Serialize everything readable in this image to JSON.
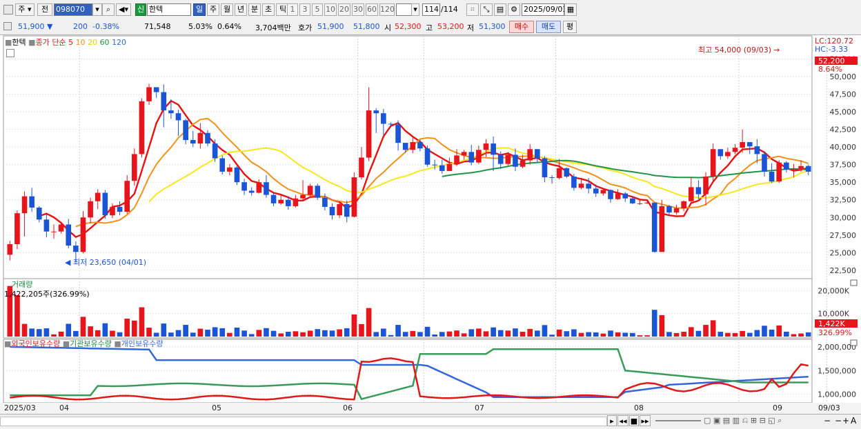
{
  "toolbar": {
    "mode_label": "주",
    "prev_label": "전",
    "code": "098070",
    "shin": "신",
    "stock_name": "한텍",
    "periods": [
      "일",
      "주",
      "월",
      "년",
      "분",
      "초",
      "틱"
    ],
    "active_period": "일",
    "nums": [
      "1",
      "3",
      "5",
      "10",
      "20",
      "30",
      "60",
      "120"
    ],
    "count": "114",
    "count_total": "/114",
    "date": "2025/09/03"
  },
  "quote": {
    "price": "51,900",
    "arrow": "▼",
    "change": "200",
    "change_pct": "-0.38%",
    "volume": "71,548",
    "vol_pct": "5.03%",
    "turnover": "0.64%",
    "value": "3,704백만",
    "hoga_label": "호가",
    "ask": "51,900",
    "bid": "51,800",
    "open_label": "시",
    "open": "52,300",
    "high_label": "고",
    "high": "53,200",
    "low_label": "저",
    "low": "51,300",
    "buy_label": "매수",
    "sell_label": "매도",
    "eval_label": "평"
  },
  "legend": {
    "name": "한텍",
    "type": "종가",
    "ma_label": "단순",
    "mas": [
      "5",
      "10",
      "20",
      "60",
      "120"
    ]
  },
  "annotations": {
    "high_text": "최고 54,000 (09/03)",
    "low_text": "최저 23,650 (04/01)",
    "lc": "LC:120.72",
    "hc": "HC:-3.33",
    "cur_price": "52,200",
    "cur_pct": "8.64%",
    "vol_title": "거래량",
    "vol_info": "1,422,205주(326.99%)",
    "vol_cur": "1,422K",
    "vol_pct": "326.99%",
    "hold_labels": [
      "외국인보유수량",
      "기관보유수량",
      "개인보유수량"
    ]
  },
  "axis": {
    "price_ticks": [
      "52,500",
      "50,000",
      "47,500",
      "45,000",
      "42,500",
      "40,000",
      "37,500",
      "35,000",
      "32,500",
      "30,000",
      "27,500",
      "25,000",
      "22,500"
    ],
    "vol_ticks": [
      "20,000K",
      "10,000K"
    ],
    "hold_ticks": [
      "2,000,000",
      "1,500,000",
      "1,000,000"
    ],
    "x_labels": [
      "2025/03",
      "04",
      "05",
      "06",
      "07",
      "08",
      "09"
    ],
    "x_end": "09/03"
  },
  "colors": {
    "up": "#e8141c",
    "down": "#1a55d8",
    "ma5": "#e81010",
    "ma10": "#f29018",
    "ma20": "#f8e81a",
    "ma60": "#1f9444",
    "ma120": "#2d6cd0",
    "foreign": "#e01818",
    "inst": "#3a9a5a",
    "indiv": "#3366dd"
  },
  "chart_data": {
    "type": "candlestick",
    "ylim": [
      21500,
      55500
    ],
    "candles": [
      [
        24700,
        26200,
        23900,
        26700
      ],
      [
        26200,
        30600,
        25500,
        31000
      ],
      [
        30600,
        33000,
        27300,
        33700
      ],
      [
        33000,
        31400,
        30800,
        34200
      ],
      [
        31400,
        29700,
        29300,
        31600
      ],
      [
        29700,
        28000,
        27200,
        30500
      ],
      [
        28000,
        28000,
        27000,
        29000
      ],
      [
        28000,
        29000,
        27700,
        29400
      ],
      [
        29000,
        26000,
        25600,
        29800
      ],
      [
        26000,
        25100,
        23650,
        26600
      ],
      [
        25100,
        30000,
        24900,
        30900
      ],
      [
        30000,
        32300,
        29200,
        32800
      ],
      [
        32300,
        33500,
        31200,
        34000
      ],
      [
        33500,
        30300,
        29800,
        33900
      ],
      [
        30300,
        31500,
        29900,
        32000
      ],
      [
        31500,
        30800,
        30300,
        32300
      ],
      [
        30800,
        35200,
        30500,
        36000
      ],
      [
        35200,
        39000,
        34500,
        39800
      ],
      [
        39000,
        46500,
        38500,
        46900
      ],
      [
        46500,
        48500,
        46000,
        49000
      ],
      [
        48500,
        47800,
        47000,
        48400
      ],
      [
        47800,
        45200,
        42800,
        48900
      ],
      [
        45200,
        44800,
        44000,
        46800
      ],
      [
        44800,
        43800,
        41600,
        45300
      ],
      [
        43800,
        41000,
        40400,
        44000
      ],
      [
        41000,
        40500,
        40000,
        42300
      ],
      [
        40500,
        42000,
        39800,
        43400
      ],
      [
        42000,
        40500,
        40100,
        42400
      ],
      [
        40500,
        38400,
        37900,
        41100
      ],
      [
        38400,
        36500,
        36100,
        38800
      ],
      [
        36500,
        37100,
        36000,
        37600
      ],
      [
        37100,
        35000,
        34600,
        37300
      ],
      [
        35000,
        33800,
        33200,
        35500
      ],
      [
        33800,
        33500,
        33100,
        34300
      ],
      [
        33500,
        35000,
        33400,
        35400
      ],
      [
        35000,
        33200,
        32800,
        36000
      ],
      [
        33200,
        32000,
        31600,
        33600
      ],
      [
        32000,
        32500,
        31800,
        33100
      ],
      [
        32500,
        31600,
        31100,
        33000
      ],
      [
        31600,
        32700,
        31400,
        33200
      ],
      [
        32700,
        33200,
        32500,
        35300
      ],
      [
        33200,
        34500,
        33000,
        34800
      ],
      [
        34500,
        32800,
        32500,
        34800
      ],
      [
        32800,
        31500,
        31000,
        33400
      ],
      [
        31500,
        30300,
        29700,
        32000
      ],
      [
        30300,
        31900,
        29900,
        32300
      ],
      [
        31900,
        30100,
        29300,
        32400
      ],
      [
        30100,
        35700,
        30000,
        36400
      ],
      [
        35700,
        38500,
        35400,
        40000
      ],
      [
        38500,
        45200,
        38000,
        48500
      ],
      [
        45200,
        44800,
        42000,
        45500
      ],
      [
        44800,
        43300,
        41700,
        45400
      ],
      [
        43300,
        43200,
        42800,
        43500
      ],
      [
        43200,
        40600,
        39500,
        43800
      ],
      [
        40600,
        39600,
        39200,
        40500
      ],
      [
        39600,
        40700,
        39100,
        41300
      ],
      [
        40700,
        39800,
        39400,
        41000
      ],
      [
        39800,
        37500,
        37200,
        40200
      ],
      [
        37500,
        37400,
        36800,
        38200
      ],
      [
        37400,
        36600,
        36200,
        38200
      ],
      [
        36600,
        37600,
        36600,
        38500
      ],
      [
        37600,
        38800,
        37300,
        39700
      ],
      [
        38800,
        39300,
        38200,
        39600
      ],
      [
        39300,
        37800,
        37400,
        40300
      ],
      [
        37800,
        39600,
        37600,
        40200
      ],
      [
        39600,
        40500,
        38600,
        41100
      ],
      [
        40500,
        38900,
        36600,
        41500
      ],
      [
        38900,
        37600,
        36900,
        39400
      ],
      [
        37600,
        38900,
        37400,
        39300
      ],
      [
        38900,
        37200,
        36600,
        39800
      ],
      [
        37200,
        38100,
        37000,
        38900
      ],
      [
        38100,
        39700,
        37500,
        40400
      ],
      [
        39700,
        38400,
        37800,
        39700
      ],
      [
        38400,
        35700,
        35000,
        38700
      ],
      [
        35700,
        35600,
        34800,
        36000
      ],
      [
        35600,
        37000,
        35400,
        38300
      ],
      [
        37000,
        35800,
        35600,
        37100
      ],
      [
        35800,
        34200,
        33800,
        36200
      ],
      [
        34200,
        34800,
        34000,
        35600
      ],
      [
        34800,
        34100,
        33400,
        35600
      ],
      [
        34100,
        33400,
        32900,
        34700
      ],
      [
        33400,
        33900,
        33100,
        34200
      ],
      [
        33900,
        32600,
        32100,
        34000
      ],
      [
        32600,
        33400,
        32500,
        34000
      ],
      [
        33400,
        32700,
        32200,
        33600
      ],
      [
        32700,
        32000,
        31900,
        33000
      ],
      [
        32000,
        32000,
        31800,
        32600
      ],
      [
        32000,
        32100,
        31900,
        32300
      ],
      [
        32100,
        25100,
        25000,
        32000
      ],
      [
        25100,
        31600,
        30500,
        32500
      ],
      [
        31600,
        30700,
        30200,
        31800
      ],
      [
        30700,
        31300,
        30400,
        31800
      ],
      [
        31300,
        32300,
        30900,
        32400
      ],
      [
        32300,
        34300,
        32000,
        35700
      ],
      [
        34300,
        33300,
        32600,
        35300
      ],
      [
        33300,
        35800,
        31700,
        36400
      ],
      [
        35800,
        39700,
        35200,
        40500
      ],
      [
        39700,
        38700,
        38200,
        39700
      ],
      [
        38700,
        39300,
        38300,
        39900
      ],
      [
        39300,
        39900,
        39000,
        40400
      ],
      [
        39900,
        40700,
        39200,
        42500
      ],
      [
        40700,
        40100,
        39000,
        40700
      ],
      [
        40100,
        39000,
        37700,
        41100
      ],
      [
        39000,
        36500,
        35800,
        39400
      ],
      [
        36500,
        35100,
        34900,
        37700
      ],
      [
        35100,
        37800,
        34900,
        38100
      ],
      [
        37800,
        36800,
        36400,
        38000
      ],
      [
        36800,
        36900,
        35700,
        37600
      ],
      [
        36900,
        37300,
        36500,
        38100
      ],
      [
        37300,
        36500,
        36000,
        37500
      ]
    ],
    "note": "Representative reading of daily OHLC candles; highest 54,000 on 09/03, lowest 23,650 on 04/01"
  }
}
